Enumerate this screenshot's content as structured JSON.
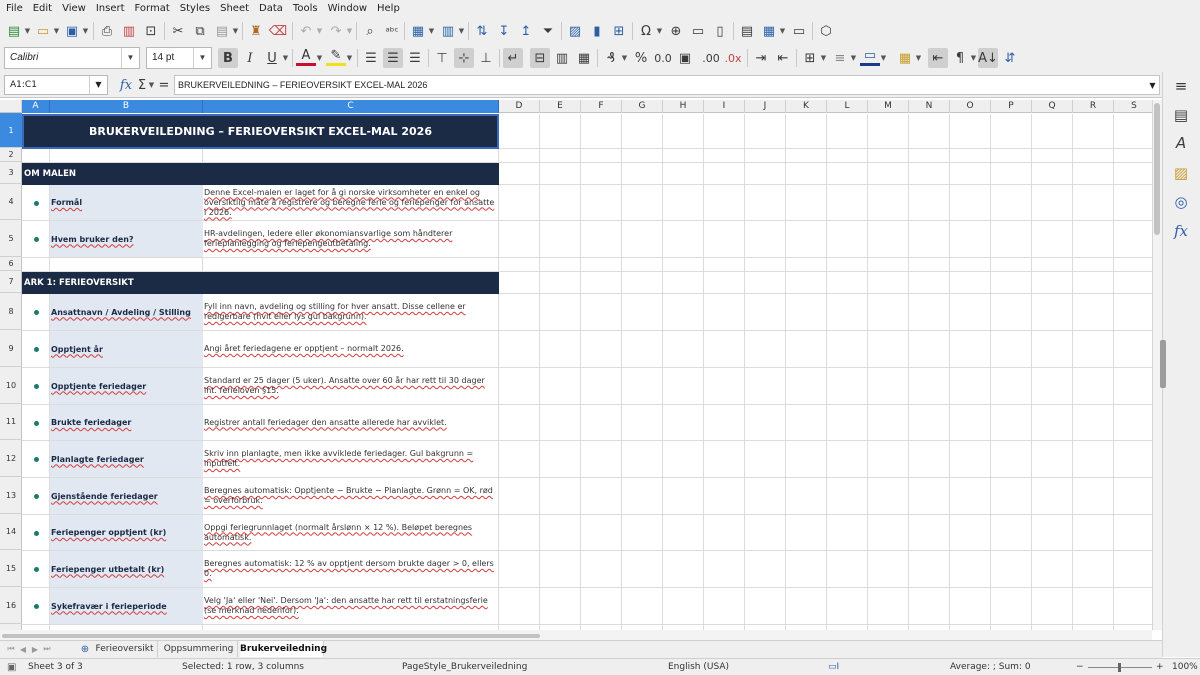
{
  "menu": [
    "File",
    "Edit",
    "View",
    "Insert",
    "Format",
    "Styles",
    "Sheet",
    "Data",
    "Tools",
    "Window",
    "Help"
  ],
  "toolbar": {
    "font_name": "Calibri",
    "font_size": "14 pt"
  },
  "formula_bar": {
    "name_box": "A1:C1",
    "content": "BRUKERVEILEDNING – FERIEOVERSIKT EXCEL-MAL 2026",
    "fx": "fx",
    "sum": "Σ",
    "equals": "="
  },
  "columns": [
    "A",
    "B",
    "C",
    "D",
    "E",
    "F",
    "G",
    "H",
    "I",
    "J",
    "K",
    "L",
    "M",
    "N",
    "O",
    "P",
    "Q",
    "R",
    "S"
  ],
  "rows": [
    "1",
    "2",
    "3",
    "4",
    "5",
    "6",
    "7",
    "8",
    "9",
    "10",
    "11",
    "12",
    "13",
    "14",
    "15",
    "16"
  ],
  "sheet": {
    "title": "BRUKERVEILEDNING – FERIEOVERSIKT EXCEL-MAL 2026",
    "sections": [
      "OM MALEN",
      "ARK 1: FERIEOVERSIKT"
    ],
    "items": [
      {
        "label": "Formål",
        "desc": "Denne Excel-malen er laget for å gi norske virksomheter en enkel og oversiktlig måte å registrere og beregne ferie og feriepenger for ansatte i 2026."
      },
      {
        "label": "Hvem bruker den?",
        "desc": "HR-avdelingen, ledere eller økonomiansvarlige som håndterer ferieplanlegging og feriepengeutbetaling."
      },
      {
        "label": "Ansattnavn / Avdeling / Stilling",
        "desc": "Fyll inn navn, avdeling og stilling for hver ansatt. Disse cellene er redigerbare (hvit eller lys gul bakgrunn)."
      },
      {
        "label": "Opptjent år",
        "desc": "Angi året feriedagene er opptjent – normalt 2026."
      },
      {
        "label": "Opptjente feriedager",
        "desc": "Standard er 25 dager (5 uker). Ansatte over 60 år har rett til 30 dager iht. ferieloven §15."
      },
      {
        "label": "Brukte feriedager",
        "desc": "Registrer antall feriedager den ansatte allerede har avviklet."
      },
      {
        "label": "Planlagte feriedager",
        "desc": "Skriv inn planlagte, men ikke avviklede feriedager. Gul bakgrunn = inputfelt."
      },
      {
        "label": "Gjenstående feriedager",
        "desc": "Beregnes automatisk: Opptjente − Brukte − Planlagte. Grønn = OK, rød = overforbruk."
      },
      {
        "label": "Feriepenger opptjent (kr)",
        "desc": "Oppgi feriegrunnlaget (normalt årslønn × 12 %). Beløpet beregnes automatisk."
      },
      {
        "label": "Feriepenger utbetalt (kr)",
        "desc": "Beregnes automatisk: 12 % av opptjent dersom brukte dager > 0, ellers 0."
      },
      {
        "label": "Sykefravær i ferieperiode",
        "desc": "Velg 'Ja' eller 'Nei'. Dersom 'Ja': den ansatte har rett til erstatningsferie (se merknad nedenfor)."
      }
    ]
  },
  "tabs": [
    "Ferieoversikt",
    "Oppsummering",
    "Brukerveiledning"
  ],
  "status": {
    "sheet": "Sheet 3 of 3",
    "selection": "Selected: 1 row, 3 columns",
    "page_style": "PageStyle_Brukerveiledning",
    "language": "English (USA)",
    "summary": "Average: ; Sum: 0",
    "zoom": "100%"
  },
  "colors": {
    "header_navy": "#1b2a45",
    "label_bg": "#e1e8f2",
    "selection": "#3c8ae0",
    "bullet": "#1c7a6a"
  }
}
